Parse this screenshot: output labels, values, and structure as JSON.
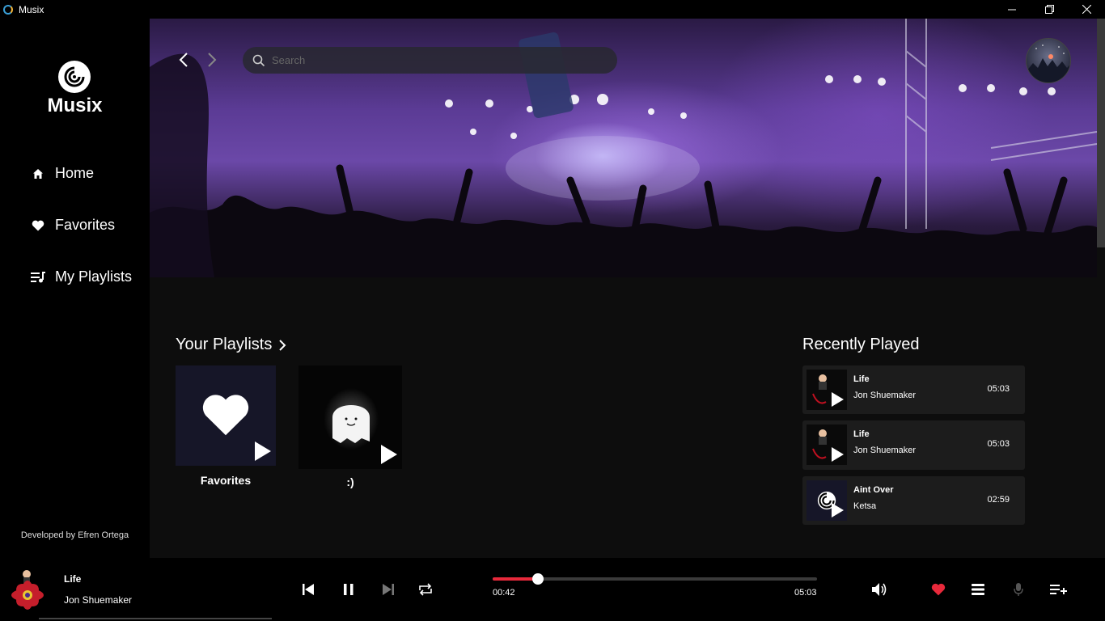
{
  "window": {
    "title": "Musix",
    "controls": [
      "minimize",
      "maximize",
      "close"
    ]
  },
  "sidebar": {
    "logo_text": "Musix",
    "nav": [
      {
        "label": "Home",
        "icon": "home-icon"
      },
      {
        "label": "Favorites",
        "icon": "heart-icon"
      },
      {
        "label": "My Playlists",
        "icon": "playlist-icon"
      }
    ],
    "credit": "Developed by Efren Ortega"
  },
  "header": {
    "search_placeholder": "Search"
  },
  "playlists": {
    "title": "Your Playlists",
    "items": [
      {
        "name": "Favorites"
      },
      {
        "name": ":)"
      }
    ]
  },
  "recent": {
    "title": "Recently Played",
    "items": [
      {
        "title": "Life",
        "artist": "Jon Shuemaker",
        "duration": "05:03"
      },
      {
        "title": "Life",
        "artist": "Jon Shuemaker",
        "duration": "05:03"
      },
      {
        "title": "Aint Over",
        "artist": "Ketsa",
        "duration": "02:59"
      }
    ]
  },
  "player": {
    "title": "Life",
    "artist": "Jon Shuemaker",
    "current_time": "00:42",
    "total_time": "05:03",
    "progress": 0.139,
    "liked": true,
    "colors": {
      "accent": "#e8293b"
    }
  }
}
